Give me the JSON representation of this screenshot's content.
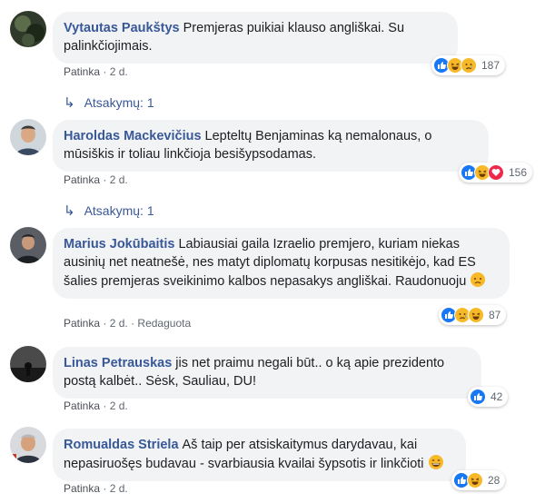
{
  "comments": [
    {
      "author": "Vytautas Paukštys",
      "text": "Premjeras puikiai klauso angliškai. Su palinkčiojimais.",
      "like_label": "Patinka",
      "time": "2 d.",
      "edited": "",
      "reaction_count": "187",
      "reactions": [
        "like-icon",
        "haha-icon",
        "sad-icon"
      ],
      "replies": "Atsakymų: 1"
    },
    {
      "author": "Haroldas Mackevičius",
      "text": "Lepteltų Benjaminas ką nemalonaus, o mūsiškis ir toliau linkčioja besišypsodamas.",
      "like_label": "Patinka",
      "time": "2 d.",
      "edited": "",
      "reaction_count": "156",
      "reactions": [
        "like-icon",
        "haha-icon",
        "love-icon"
      ],
      "replies": "Atsakymų: 1"
    },
    {
      "author": "Marius Jokūbaitis",
      "text": "Labiausiai gaila Izraelio premjero, kuriam niekas ausinių net neatnešė, nes matyt diplomatų korpusas nesitikėjo, kad ES šalies premjeras sveikinimo kalbos nepasakys angliškai. Raudonuoju",
      "like_label": "Patinka",
      "time": "2 d.",
      "edited": "Redaguota",
      "reaction_count": "87",
      "reactions": [
        "like-icon",
        "sad-icon",
        "haha-icon"
      ],
      "replies": ""
    },
    {
      "author": "Linas Petrauskas",
      "text": "jis net praimu negali būt.. o ką apie prezidento postą kalbėt.. Sėsk, Sauliau, DU!",
      "like_label": "Patinka",
      "time": "2 d.",
      "edited": "",
      "reaction_count": "42",
      "reactions": [
        "like-icon"
      ],
      "replies": ""
    },
    {
      "author": "Romualdas Striela",
      "text": "Aš taip per atsiskaitymus darydavau, kai nepasiruošęs budavau - svarbiausia kvailai šypsotis ir linkčioti",
      "like_label": "Patinka",
      "time": "2 d.",
      "edited": "",
      "reaction_count": "28",
      "reactions": [
        "like-icon",
        "haha-icon"
      ],
      "replies": ""
    }
  ],
  "separator": "·",
  "colors": {
    "author": "#385898",
    "bubble": "#f2f3f5",
    "meta": "#606770",
    "like": "#1877f2",
    "haha": "#f7b928",
    "love": "#f0284a"
  }
}
